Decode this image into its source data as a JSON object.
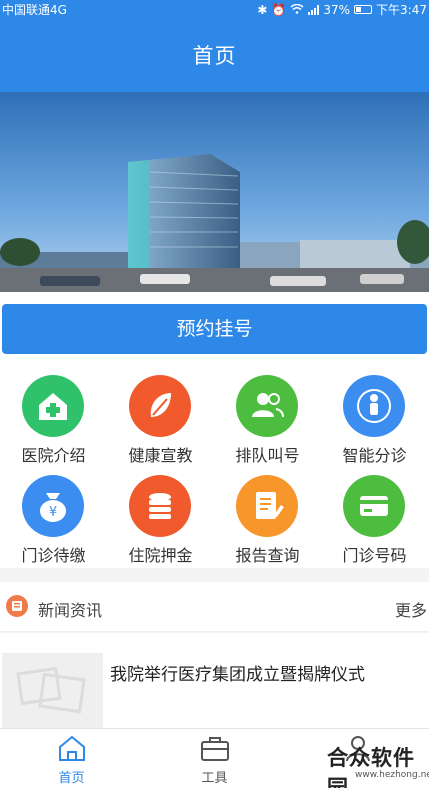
{
  "status_bar": {
    "carrier": "中国联通4G",
    "battery": "37%",
    "battery_level": 0.37,
    "time": "下午3:47",
    "network": "4G"
  },
  "header": {
    "title": "首页"
  },
  "book_button": {
    "label": "预约挂号"
  },
  "colors": {
    "brand_blue": "#2e88e8",
    "green": "#2fc26b",
    "orange_red": "#f05a2d",
    "lime_green": "#4cbd3f",
    "sky_blue": "#3b8ef0",
    "orange": "#f7962b"
  },
  "grid": {
    "items": [
      {
        "label": "医院介绍",
        "icon": "hospital-icon",
        "color": "#2fc26b"
      },
      {
        "label": "健康宣教",
        "icon": "leaf-icon",
        "color": "#f05a2d"
      },
      {
        "label": "排队叫号",
        "icon": "people-icon",
        "color": "#4cbd3f"
      },
      {
        "label": "智能分诊",
        "icon": "person-signal-icon",
        "color": "#3b8ef0"
      },
      {
        "label": "门诊待缴",
        "icon": "money-bag-icon",
        "color": "#3b8ef0"
      },
      {
        "label": "住院押金",
        "icon": "coins-icon",
        "color": "#f05a2d"
      },
      {
        "label": "报告查询",
        "icon": "report-icon",
        "color": "#f7962b"
      },
      {
        "label": "门诊号码",
        "icon": "card-icon",
        "color": "#4cbd3f"
      }
    ]
  },
  "news": {
    "section_title": "新闻资讯",
    "more_label": "更多",
    "items": [
      {
        "title": "我院举行医疗集团成立暨揭牌仪式"
      }
    ]
  },
  "tabbar": {
    "tabs": [
      {
        "label": "首页",
        "icon": "home-icon",
        "active": true
      },
      {
        "label": "工具",
        "icon": "toolbox-icon",
        "active": false
      },
      {
        "label": "",
        "icon": "user-icon",
        "active": false
      }
    ]
  },
  "watermark": {
    "text": "合众软件园",
    "url": "www.hezhong.net"
  }
}
